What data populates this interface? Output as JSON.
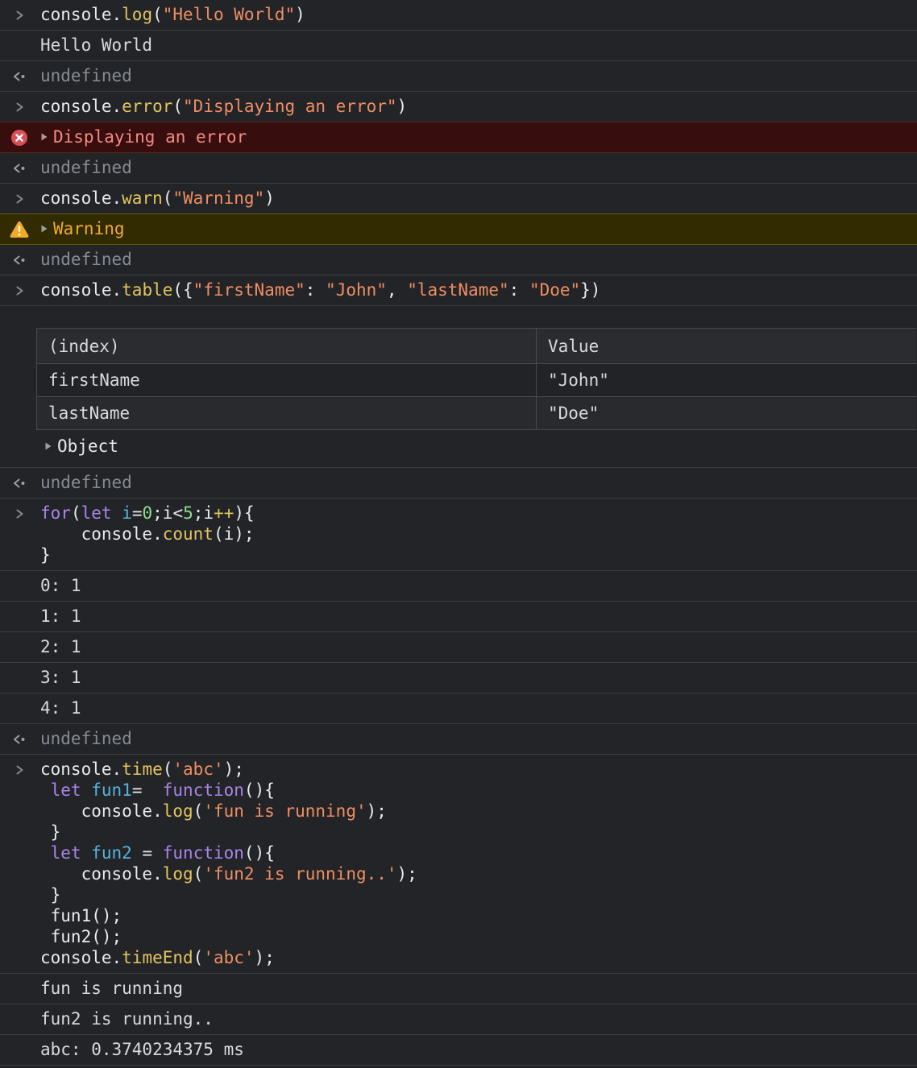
{
  "meta": {
    "app": "devtools-console",
    "theme": "dark"
  },
  "colors": {
    "background": "#232428",
    "divider": "#3a3d42",
    "text_default": "#e8eaed",
    "text_result": "#d6dadf",
    "text_muted": "#868c94",
    "token_function": "#e2c55e",
    "token_string": "#ef8e62",
    "token_keyword": "#a984e6",
    "token_variable": "#55b2e0",
    "token_number": "#8ddd8d",
    "token_operator": "#e2c55e",
    "error_bg": "#380d0e",
    "error_border": "#5c2120",
    "error_text": "#f28b82",
    "error_icon": "#d94f56",
    "error_triangle": "#b99598",
    "warn_bg": "#332b00",
    "warn_border": "#66550a",
    "warn_text": "#f2ab26",
    "warn_icon": "#f2ab26",
    "icon_gray": "#9aa0a6",
    "icon_input": "#858b92",
    "table_border": "#474a4e",
    "table_header_bg": "#2b2c30",
    "table_row_odd_bg": "#222327",
    "table_row_even_bg": "#292a2e",
    "table_string": "#31c8c0"
  },
  "icons": {
    "input": "chevron-right-icon",
    "return": "return-value-icon",
    "error": "error-circle-icon",
    "warn": "warning-triangle-icon",
    "expand": "disclosure-triangle-icon"
  },
  "rows": [
    {
      "type": "input",
      "lines": [
        [
          {
            "t": "console.",
            "c": "d"
          },
          {
            "t": "log",
            "c": "fn"
          },
          {
            "t": "(",
            "c": "d"
          },
          {
            "t": "\"Hello World\"",
            "c": "str"
          },
          {
            "t": ")",
            "c": "d"
          }
        ]
      ]
    },
    {
      "type": "log",
      "lines": [
        [
          {
            "t": "Hello World",
            "c": "res"
          }
        ]
      ]
    },
    {
      "type": "return",
      "lines": [
        [
          {
            "t": "undefined",
            "c": "mut"
          }
        ]
      ]
    },
    {
      "type": "input",
      "lines": [
        [
          {
            "t": "console.",
            "c": "d"
          },
          {
            "t": "error",
            "c": "fn"
          },
          {
            "t": "(",
            "c": "d"
          },
          {
            "t": "\"Displaying an error\"",
            "c": "str"
          },
          {
            "t": ")",
            "c": "d"
          }
        ]
      ]
    },
    {
      "type": "error",
      "label": "Displaying an error"
    },
    {
      "type": "return",
      "lines": [
        [
          {
            "t": "undefined",
            "c": "mut"
          }
        ]
      ]
    },
    {
      "type": "input",
      "lines": [
        [
          {
            "t": "console.",
            "c": "d"
          },
          {
            "t": "warn",
            "c": "fn"
          },
          {
            "t": "(",
            "c": "d"
          },
          {
            "t": "\"Warning\"",
            "c": "str"
          },
          {
            "t": ")",
            "c": "d"
          }
        ]
      ]
    },
    {
      "type": "warn",
      "label": "Warning"
    },
    {
      "type": "return",
      "lines": [
        [
          {
            "t": "undefined",
            "c": "mut"
          }
        ]
      ]
    },
    {
      "type": "input",
      "lines": [
        [
          {
            "t": "console.",
            "c": "d"
          },
          {
            "t": "table",
            "c": "fn"
          },
          {
            "t": "({",
            "c": "d"
          },
          {
            "t": "\"firstName\"",
            "c": "str"
          },
          {
            "t": ": ",
            "c": "d"
          },
          {
            "t": "\"John\"",
            "c": "str"
          },
          {
            "t": ", ",
            "c": "d"
          },
          {
            "t": "\"lastName\"",
            "c": "str"
          },
          {
            "t": ": ",
            "c": "d"
          },
          {
            "t": "\"Doe\"",
            "c": "str"
          },
          {
            "t": "})",
            "c": "d"
          }
        ]
      ]
    },
    {
      "type": "table",
      "table": {
        "headers": [
          "(index)",
          "Value"
        ],
        "rows": [
          {
            "key": "firstName",
            "value": "\"John\""
          },
          {
            "key": "lastName",
            "value": "\"Doe\""
          }
        ]
      },
      "object_label": "Object"
    },
    {
      "type": "return",
      "lines": [
        [
          {
            "t": "undefined",
            "c": "mut"
          }
        ]
      ]
    },
    {
      "type": "input",
      "lines": [
        [
          {
            "t": "for",
            "c": "kw"
          },
          {
            "t": "(",
            "c": "d"
          },
          {
            "t": "let",
            "c": "kw"
          },
          {
            "t": " ",
            "c": "d"
          },
          {
            "t": "i",
            "c": "var"
          },
          {
            "t": "=",
            "c": "d"
          },
          {
            "t": "0",
            "c": "num"
          },
          {
            "t": ";i",
            "c": "d"
          },
          {
            "t": "<",
            "c": "d"
          },
          {
            "t": "5",
            "c": "num"
          },
          {
            "t": ";i",
            "c": "d"
          },
          {
            "t": "++",
            "c": "op"
          },
          {
            "t": "){",
            "c": "d"
          }
        ],
        [
          {
            "t": "    console.",
            "c": "d"
          },
          {
            "t": "count",
            "c": "fn"
          },
          {
            "t": "(i);",
            "c": "d"
          }
        ],
        [
          {
            "t": "}",
            "c": "d"
          }
        ]
      ]
    },
    {
      "type": "log",
      "lines": [
        [
          {
            "t": "0: 1",
            "c": "res"
          }
        ]
      ]
    },
    {
      "type": "log",
      "lines": [
        [
          {
            "t": "1: 1",
            "c": "res"
          }
        ]
      ]
    },
    {
      "type": "log",
      "lines": [
        [
          {
            "t": "2: 1",
            "c": "res"
          }
        ]
      ]
    },
    {
      "type": "log",
      "lines": [
        [
          {
            "t": "3: 1",
            "c": "res"
          }
        ]
      ]
    },
    {
      "type": "log",
      "lines": [
        [
          {
            "t": "4: 1",
            "c": "res"
          }
        ]
      ]
    },
    {
      "type": "return",
      "lines": [
        [
          {
            "t": "undefined",
            "c": "mut"
          }
        ]
      ]
    },
    {
      "type": "input",
      "lines": [
        [
          {
            "t": "console.",
            "c": "d"
          },
          {
            "t": "time",
            "c": "fn"
          },
          {
            "t": "(",
            "c": "d"
          },
          {
            "t": "'abc'",
            "c": "str"
          },
          {
            "t": ");",
            "c": "d"
          }
        ],
        [
          {
            "t": " ",
            "c": "d"
          },
          {
            "t": "let",
            "c": "kw"
          },
          {
            "t": " ",
            "c": "d"
          },
          {
            "t": "fun1",
            "c": "var"
          },
          {
            "t": "=  ",
            "c": "d"
          },
          {
            "t": "function",
            "c": "kw"
          },
          {
            "t": "(){",
            "c": "d"
          }
        ],
        [
          {
            "t": "    console.",
            "c": "d"
          },
          {
            "t": "log",
            "c": "fn"
          },
          {
            "t": "(",
            "c": "d"
          },
          {
            "t": "'fun is running'",
            "c": "str"
          },
          {
            "t": ");",
            "c": "d"
          }
        ],
        [
          {
            "t": " }",
            "c": "d"
          }
        ],
        [
          {
            "t": " ",
            "c": "d"
          },
          {
            "t": "let",
            "c": "kw"
          },
          {
            "t": " ",
            "c": "d"
          },
          {
            "t": "fun2",
            "c": "var"
          },
          {
            "t": " = ",
            "c": "d"
          },
          {
            "t": "function",
            "c": "kw"
          },
          {
            "t": "(){",
            "c": "d"
          }
        ],
        [
          {
            "t": "    console.",
            "c": "d"
          },
          {
            "t": "log",
            "c": "fn"
          },
          {
            "t": "(",
            "c": "d"
          },
          {
            "t": "'fun2 is running..'",
            "c": "str"
          },
          {
            "t": ");",
            "c": "d"
          }
        ],
        [
          {
            "t": " }",
            "c": "d"
          }
        ],
        [
          {
            "t": " fun1();",
            "c": "d"
          }
        ],
        [
          {
            "t": " fun2();",
            "c": "d"
          }
        ],
        [
          {
            "t": "console.",
            "c": "d"
          },
          {
            "t": "timeEnd",
            "c": "fn"
          },
          {
            "t": "(",
            "c": "d"
          },
          {
            "t": "'abc'",
            "c": "str"
          },
          {
            "t": ");",
            "c": "d"
          }
        ]
      ]
    },
    {
      "type": "log",
      "lines": [
        [
          {
            "t": "fun is running",
            "c": "res"
          }
        ]
      ]
    },
    {
      "type": "log",
      "lines": [
        [
          {
            "t": "fun2 is running..",
            "c": "res"
          }
        ]
      ]
    },
    {
      "type": "log",
      "lines": [
        [
          {
            "t": "abc: 0.3740234375 ms",
            "c": "res"
          }
        ]
      ]
    }
  ]
}
